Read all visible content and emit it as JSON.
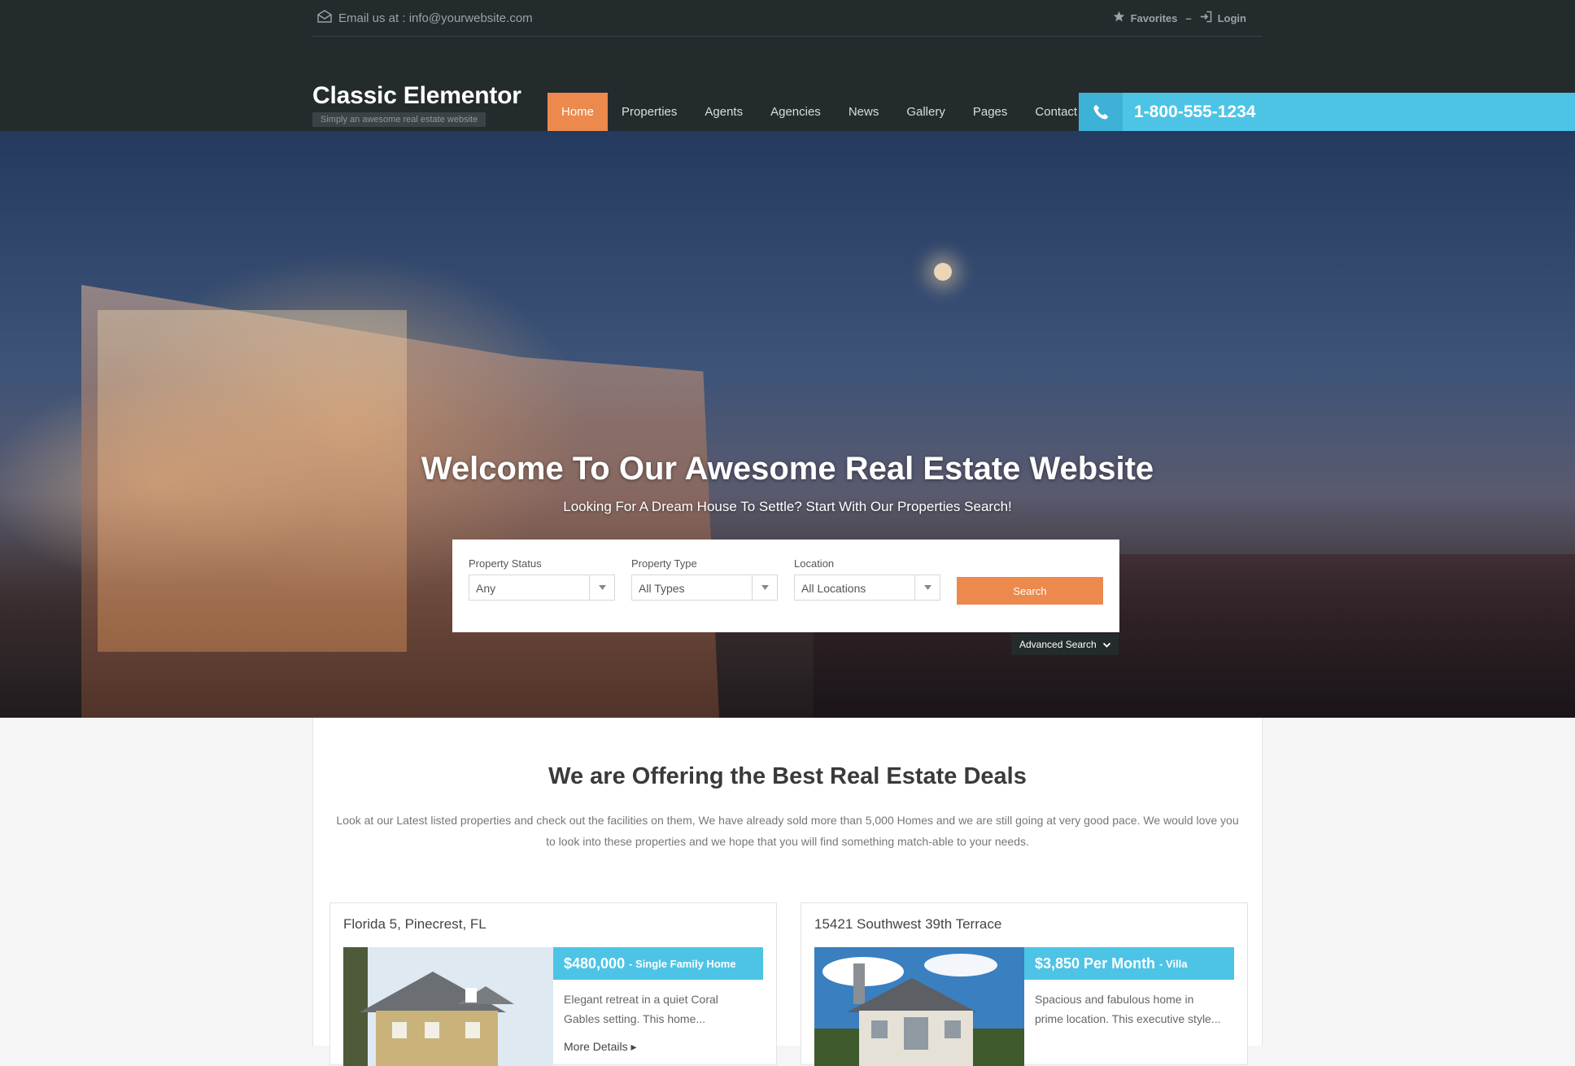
{
  "topbar": {
    "email_text": "Email us at : info@yourwebsite.com",
    "favorites_label": "Favorites",
    "separator": "–",
    "login_label": "Login"
  },
  "header": {
    "site_title": "Classic Elementor",
    "tagline": "Simply an awesome real estate website",
    "phone": "1-800-555-1234"
  },
  "nav": {
    "items": [
      {
        "label": "Home",
        "active": true
      },
      {
        "label": "Properties"
      },
      {
        "label": "Agents"
      },
      {
        "label": "Agencies"
      },
      {
        "label": "News"
      },
      {
        "label": "Gallery"
      },
      {
        "label": "Pages"
      },
      {
        "label": "Contact"
      }
    ]
  },
  "hero": {
    "title": "Welcome To Our Awesome Real Estate Website",
    "subtitle": "Looking For A Dream House To Settle? Start With Our Properties Search!"
  },
  "search": {
    "status": {
      "label": "Property Status",
      "value": "Any"
    },
    "type": {
      "label": "Property Type",
      "value": "All Types"
    },
    "location": {
      "label": "Location",
      "value": "All Locations"
    },
    "button_label": "Search",
    "advanced_label": "Advanced Search"
  },
  "section": {
    "title": "We are Offering the Best Real Estate Deals",
    "text": "Look at our Latest listed properties and check out the facilities on them, We have already sold more than 5,000 Homes and we are still going at very good pace. We would love you to look into these properties and we hope that you will find something match-able to your needs."
  },
  "properties": [
    {
      "title": "Florida 5, Pinecrest, FL",
      "price": "$480,000",
      "type": "- Single Family Home",
      "description": "Elegant retreat in a quiet Coral Gables setting. This home...",
      "more_label": "More Details"
    },
    {
      "title": "15421 Southwest 39th Terrace",
      "price": "$3,850 Per Month",
      "type": "- Villa",
      "description": "Spacious and fabulous home in prime location. This executive style..."
    }
  ],
  "colors": {
    "header_bg": "#242b2d",
    "accent_orange": "#ec894d",
    "accent_blue": "#4dc4e6"
  }
}
